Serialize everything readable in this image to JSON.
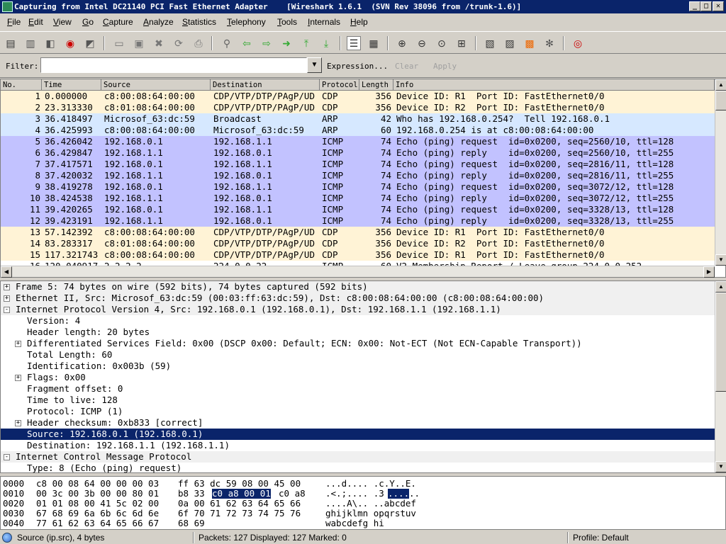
{
  "window": {
    "title": "Capturing from Intel DC21140 PCI Fast Ethernet Adapter    [Wireshark 1.6.1  (SVN Rev 38096 from /trunk-1.6)]",
    "buttons": [
      "_",
      "□",
      "✕"
    ]
  },
  "menu": [
    "File",
    "Edit",
    "View",
    "Go",
    "Capture",
    "Analyze",
    "Statistics",
    "Telephony",
    "Tools",
    "Internals",
    "Help"
  ],
  "toolbar": {
    "icons": [
      "interface-list-icon",
      "capture-options-icon",
      "start-capture-icon",
      "stop-capture-icon",
      "restart-capture-icon",
      "open-file-icon",
      "save-file-icon",
      "close-file-icon",
      "reload-icon",
      "print-icon",
      "find-packet-icon",
      "go-back-icon",
      "go-forward-icon",
      "go-to-packet-icon",
      "go-first-icon",
      "go-last-icon",
      "colorize-icon",
      "auto-scroll-icon",
      "zoom-in-icon",
      "zoom-out-icon",
      "normal-size-icon",
      "resize-columns-icon",
      "capture-filters-icon",
      "display-filters-icon",
      "coloring-rules-icon",
      "preferences-icon",
      "help-icon"
    ]
  },
  "filter": {
    "label": "Filter:",
    "value": "",
    "expression": "Expression...",
    "clear": "Clear",
    "apply": "Apply"
  },
  "packet_list": {
    "columns": [
      "No.",
      "Time",
      "Source",
      "Destination",
      "Protocol",
      "Length",
      "Info"
    ],
    "rows": [
      {
        "no": "1",
        "time": "0.000000",
        "src": "c8:00:08:64:00:00",
        "dst": "CDP/VTP/DTP/PAgP/UD",
        "proto": "CDP",
        "len": "356",
        "info": "Device ID: R1  Port ID: FastEthernet0/0",
        "bg": "#fff3d6"
      },
      {
        "no": "2",
        "time": "23.313330",
        "src": "c8:01:08:64:00:00",
        "dst": "CDP/VTP/DTP/PAgP/UD",
        "proto": "CDP",
        "len": "356",
        "info": "Device ID: R2  Port ID: FastEthernet0/0",
        "bg": "#fff3d6"
      },
      {
        "no": "3",
        "time": "36.418497",
        "src": "Microsof_63:dc:59",
        "dst": "Broadcast",
        "proto": "ARP",
        "len": "42",
        "info": "Who has 192.168.0.254?  Tell 192.168.0.1",
        "bg": "#d6e8ff"
      },
      {
        "no": "4",
        "time": "36.425993",
        "src": "c8:00:08:64:00:00",
        "dst": "Microsof_63:dc:59",
        "proto": "ARP",
        "len": "60",
        "info": "192.168.0.254 is at c8:00:08:64:00:00",
        "bg": "#d6e8ff"
      },
      {
        "no": "5",
        "time": "36.426042",
        "src": "192.168.0.1",
        "dst": "192.168.1.1",
        "proto": "ICMP",
        "len": "74",
        "info": "Echo (ping) request  id=0x0200, seq=2560/10, ttl=128",
        "bg": "#c2c2ff",
        "selected": true
      },
      {
        "no": "6",
        "time": "36.429847",
        "src": "192.168.1.1",
        "dst": "192.168.0.1",
        "proto": "ICMP",
        "len": "74",
        "info": "Echo (ping) reply    id=0x0200, seq=2560/10, ttl=255",
        "bg": "#c2c2ff"
      },
      {
        "no": "7",
        "time": "37.417571",
        "src": "192.168.0.1",
        "dst": "192.168.1.1",
        "proto": "ICMP",
        "len": "74",
        "info": "Echo (ping) request  id=0x0200, seq=2816/11, ttl=128",
        "bg": "#c2c2ff"
      },
      {
        "no": "8",
        "time": "37.420032",
        "src": "192.168.1.1",
        "dst": "192.168.0.1",
        "proto": "ICMP",
        "len": "74",
        "info": "Echo (ping) reply    id=0x0200, seq=2816/11, ttl=255",
        "bg": "#c2c2ff"
      },
      {
        "no": "9",
        "time": "38.419278",
        "src": "192.168.0.1",
        "dst": "192.168.1.1",
        "proto": "ICMP",
        "len": "74",
        "info": "Echo (ping) request  id=0x0200, seq=3072/12, ttl=128",
        "bg": "#c2c2ff"
      },
      {
        "no": "10",
        "time": "38.424538",
        "src": "192.168.1.1",
        "dst": "192.168.0.1",
        "proto": "ICMP",
        "len": "74",
        "info": "Echo (ping) reply    id=0x0200, seq=3072/12, ttl=255",
        "bg": "#c2c2ff"
      },
      {
        "no": "11",
        "time": "39.420265",
        "src": "192.168.0.1",
        "dst": "192.168.1.1",
        "proto": "ICMP",
        "len": "74",
        "info": "Echo (ping) request  id=0x0200, seq=3328/13, ttl=128",
        "bg": "#c2c2ff"
      },
      {
        "no": "12",
        "time": "39.423191",
        "src": "192.168.1.1",
        "dst": "192.168.0.1",
        "proto": "ICMP",
        "len": "74",
        "info": "Echo (ping) reply    id=0x0200, seq=3328/13, ttl=255",
        "bg": "#c2c2ff"
      },
      {
        "no": "13",
        "time": "57.142392",
        "src": "c8:00:08:64:00:00",
        "dst": "CDP/VTP/DTP/PAgP/UD",
        "proto": "CDP",
        "len": "356",
        "info": "Device ID: R1  Port ID: FastEthernet0/0",
        "bg": "#fff3d6"
      },
      {
        "no": "14",
        "time": "83.283317",
        "src": "c8:01:08:64:00:00",
        "dst": "CDP/VTP/DTP/PAgP/UD",
        "proto": "CDP",
        "len": "356",
        "info": "Device ID: R2  Port ID: FastEthernet0/0",
        "bg": "#fff3d6"
      },
      {
        "no": "15",
        "time": "117.321743",
        "src": "c8:00:08:64:00:00",
        "dst": "CDP/VTP/DTP/PAgP/UD",
        "proto": "CDP",
        "len": "356",
        "info": "Device ID: R1  Port ID: FastEthernet0/0",
        "bg": "#fff3d6"
      },
      {
        "no": "16",
        "time": "120.040917",
        "src": "2.2.2.2",
        "dst": "224.0.0.22",
        "proto": "ICMP",
        "len": "60",
        "info": "V2 Membership Report / Leave group 224.0.0.252",
        "bg": "#fff"
      }
    ]
  },
  "details": [
    {
      "level": 0,
      "exp": "+",
      "text": "Frame 5: 74 bytes on wire (592 bits), 74 bytes captured (592 bits)",
      "shaded": true
    },
    {
      "level": 0,
      "exp": "+",
      "text": "Ethernet II, Src: Microsof_63:dc:59 (00:03:ff:63:dc:59), Dst: c8:00:08:64:00:00 (c8:00:08:64:00:00)",
      "shaded": true
    },
    {
      "level": 0,
      "exp": "-",
      "text": "Internet Protocol Version 4, Src: 192.168.0.1 (192.168.0.1), Dst: 192.168.1.1 (192.168.1.1)",
      "shaded": true
    },
    {
      "level": 1,
      "exp": "",
      "text": "Version: 4"
    },
    {
      "level": 1,
      "exp": "",
      "text": "Header length: 20 bytes"
    },
    {
      "level": 1,
      "exp": "+",
      "text": "Differentiated Services Field: 0x00 (DSCP 0x00: Default; ECN: 0x00: Not-ECT (Not ECN-Capable Transport))"
    },
    {
      "level": 1,
      "exp": "",
      "text": "Total Length: 60"
    },
    {
      "level": 1,
      "exp": "",
      "text": "Identification: 0x003b (59)"
    },
    {
      "level": 1,
      "exp": "+",
      "text": "Flags: 0x00"
    },
    {
      "level": 1,
      "exp": "",
      "text": "Fragment offset: 0"
    },
    {
      "level": 1,
      "exp": "",
      "text": "Time to live: 128"
    },
    {
      "level": 1,
      "exp": "",
      "text": "Protocol: ICMP (1)"
    },
    {
      "level": 1,
      "exp": "+",
      "text": "Header checksum: 0xb833 [correct]"
    },
    {
      "level": 1,
      "exp": "",
      "text": "Source: 192.168.0.1 (192.168.0.1)",
      "selected": true
    },
    {
      "level": 1,
      "exp": "",
      "text": "Destination: 192.168.1.1 (192.168.1.1)"
    },
    {
      "level": 0,
      "exp": "-",
      "text": "Internet Control Message Protocol",
      "shaded": true
    },
    {
      "level": 1,
      "exp": "",
      "text": "Type: 8 (Echo (ping) request)"
    }
  ],
  "bytes": [
    {
      "offset": "0000",
      "hex_a": "c8 00 08 64 00 00 00 03",
      "hex_b": "ff 63 dc 59 08 00 45 00",
      "ascii": "...d.... .c.Y..E."
    },
    {
      "offset": "0010",
      "hex_a": "00 3c 00 3b 00 00 80 01",
      "hex_b": "b8 33",
      "hex_hl": "c0 a8 00 01",
      "hex_c": "c0 a8",
      "ascii_a": ".<.;.... .3",
      "ascii_hl": "....",
      "ascii_c": ".."
    },
    {
      "offset": "0020",
      "hex_a": "01 01 08 00 41 5c 02 00",
      "hex_b": "0a 00 61 62 63 64 65 66",
      "ascii": "....A\\.. ..abcdef"
    },
    {
      "offset": "0030",
      "hex_a": "67 68 69 6a 6b 6c 6d 6e",
      "hex_b": "6f 70 71 72 73 74 75 76",
      "ascii": "ghijklmn opqrstuv"
    },
    {
      "offset": "0040",
      "hex_a": "77 61 62 63 64 65 66 67",
      "hex_b": "68 69",
      "ascii": "wabcdefg hi"
    }
  ],
  "status": {
    "field": "Source (ip.src), 4 bytes",
    "packets": "Packets: 127 Displayed: 127 Marked: 0",
    "profile": "Profile: Default"
  }
}
